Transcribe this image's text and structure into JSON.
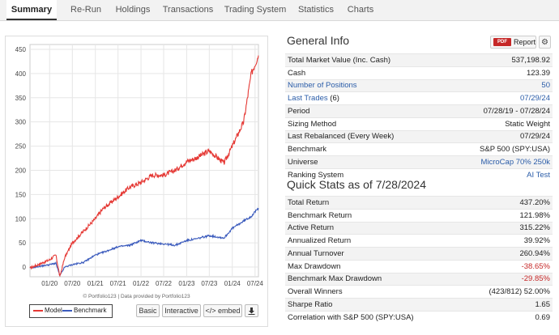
{
  "tabs": [
    {
      "label": "Summary",
      "active": true
    },
    {
      "label": "Re-Run"
    },
    {
      "label": "Holdings"
    },
    {
      "label": "Transactions"
    },
    {
      "label": "Trading System"
    },
    {
      "label": "Statistics"
    },
    {
      "label": "Charts"
    }
  ],
  "chart_data": {
    "type": "line",
    "x_ticks": [
      "01/20",
      "07/20",
      "01/21",
      "07/21",
      "01/22",
      "07/22",
      "01/23",
      "07/23",
      "01/24",
      "07/24"
    ],
    "y_ticks": [
      0,
      50,
      100,
      150,
      200,
      250,
      300,
      350,
      400,
      450
    ],
    "ylim": [
      -20,
      460
    ],
    "xlim": [
      "2019-07-28",
      "2024-07-28"
    ],
    "grid": true,
    "legend_placement": "bottom-left",
    "series": [
      {
        "name": "Model",
        "color": "#e53935",
        "x": [
          "2019-07-28",
          "2019-10-01",
          "2020-01-01",
          "2020-02-20",
          "2020-03-23",
          "2020-05-01",
          "2020-07-01",
          "2020-10-01",
          "2021-01-01",
          "2021-03-01",
          "2021-07-01",
          "2021-10-01",
          "2022-01-01",
          "2022-04-01",
          "2022-07-01",
          "2022-10-01",
          "2023-01-01",
          "2023-03-15",
          "2023-07-01",
          "2023-10-27",
          "2024-01-01",
          "2024-04-01",
          "2024-06-01",
          "2024-07-28"
        ],
        "values": [
          -2,
          5,
          15,
          25,
          -20,
          20,
          50,
          75,
          100,
          120,
          145,
          165,
          175,
          190,
          190,
          200,
          218,
          225,
          240,
          215,
          250,
          300,
          400,
          437.2
        ]
      },
      {
        "name": "Benchmark",
        "color": "#3b5bbd",
        "x": [
          "2019-07-28",
          "2019-10-01",
          "2020-01-01",
          "2020-02-20",
          "2020-03-23",
          "2020-05-01",
          "2020-07-01",
          "2020-10-01",
          "2021-01-01",
          "2021-03-01",
          "2021-07-01",
          "2021-10-01",
          "2022-01-01",
          "2022-04-01",
          "2022-07-01",
          "2022-10-01",
          "2023-01-01",
          "2023-03-15",
          "2023-07-01",
          "2023-10-27",
          "2024-01-01",
          "2024-04-01",
          "2024-06-01",
          "2024-07-28"
        ],
        "values": [
          -2,
          1,
          5,
          8,
          -18,
          0,
          5,
          10,
          25,
          30,
          42,
          45,
          55,
          50,
          48,
          45,
          55,
          58,
          65,
          60,
          80,
          95,
          105,
          121.98
        ]
      }
    ]
  },
  "chart_credit": "© Portfolio123 | Data provided by Portfolio123",
  "chart_buttons": {
    "basic": "Basic",
    "interactive": "Interactive",
    "embed": "</> embed",
    "download_icon": "download-icon"
  },
  "general_info": {
    "title": "General Info",
    "report_badge": "PDF",
    "report_label": "Report",
    "settings_icon": "gear-icon",
    "rows": [
      {
        "label": "Total Market Value (Inc. Cash)",
        "value": "537,198.92"
      },
      {
        "label": "Cash",
        "value": "123.39"
      },
      {
        "label": "Number of Positions",
        "value": "50",
        "label_link": true,
        "value_link": true
      },
      {
        "label": "Last Trades",
        "label_suffix": " (6)",
        "value": "07/29/24",
        "label_link": true,
        "value_link": true
      },
      {
        "label": "Period",
        "value": "07/28/19 - 07/28/24"
      },
      {
        "label": "Sizing Method",
        "value": "Static Weight"
      },
      {
        "label": "Last Rebalanced (Every Week)",
        "value": "07/29/24"
      },
      {
        "label": "Benchmark",
        "value": "S&P 500 (SPY:USA)"
      },
      {
        "label": "Universe",
        "value": "MicroCap 70% 250k",
        "value_link": true
      },
      {
        "label": "Ranking System",
        "value": "AI Test",
        "value_link": true
      }
    ]
  },
  "quick_stats": {
    "title": "Quick Stats as of 7/28/2024",
    "rows": [
      {
        "label": "Total Return",
        "value": "437.20%"
      },
      {
        "label": "Benchmark Return",
        "value": "121.98%"
      },
      {
        "label": "Active Return",
        "value": "315.22%"
      },
      {
        "label": "Annualized Return",
        "value": "39.92%"
      },
      {
        "label": "Annual Turnover",
        "value": "260.94%"
      },
      {
        "label": "Max Drawdown",
        "value": "-38.65%",
        "negative": true
      },
      {
        "label": "Benchmark Max Drawdown",
        "value": "-29.85%",
        "negative": true
      },
      {
        "label": "Overall Winners",
        "value": "(423/812) 52.00%"
      },
      {
        "label": "Sharpe Ratio",
        "value": "1.65"
      },
      {
        "label": "Correlation with S&P 500 (SPY:USA)",
        "value": "0.69"
      }
    ]
  }
}
